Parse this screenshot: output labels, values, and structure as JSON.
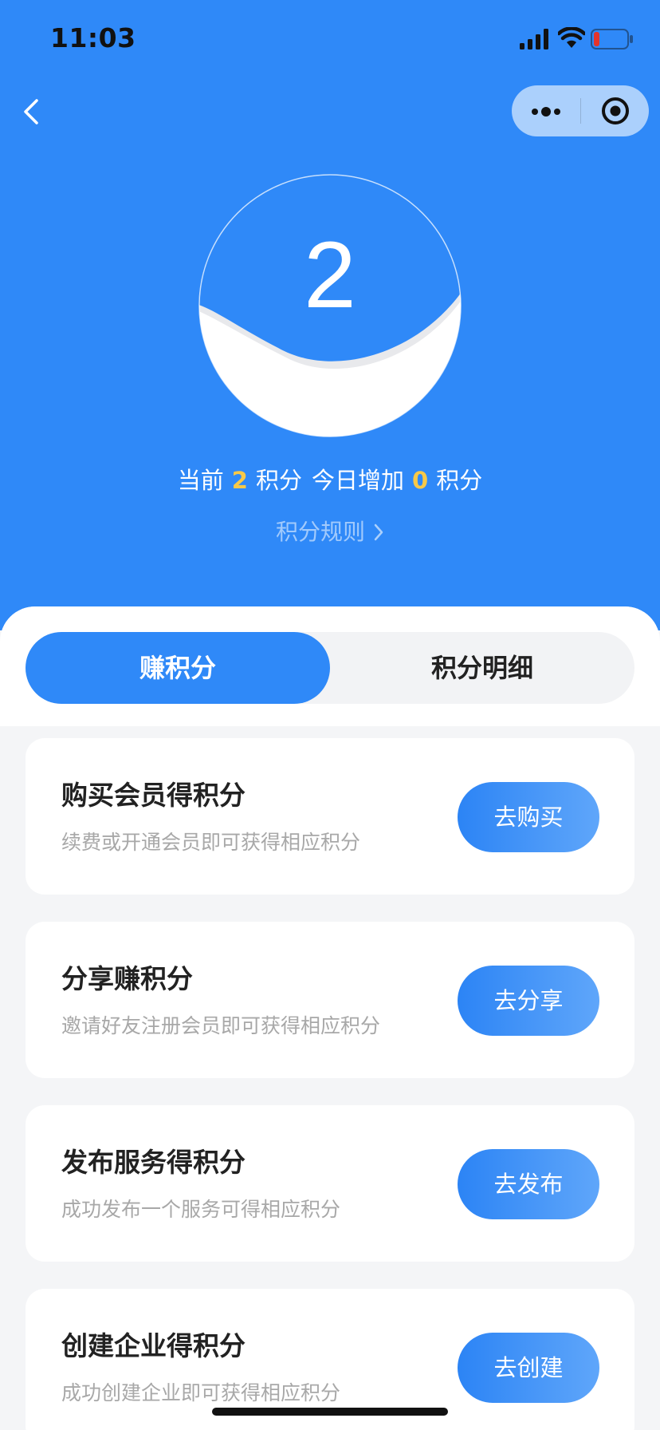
{
  "status_bar": {
    "time": "11:03"
  },
  "nav": {
    "back_icon": "chevron-left-icon",
    "capsule_more_icon": "more-dots-icon",
    "capsule_close_icon": "target-close-icon"
  },
  "points": {
    "current_value": "2",
    "summary_prefix": "当前",
    "current": "2",
    "points_unit": "积分",
    "today_label": "今日增加",
    "today_added": "0",
    "rules_link": "积分规则"
  },
  "tabs": [
    {
      "label": "赚积分",
      "active": true
    },
    {
      "label": "积分明细",
      "active": false
    }
  ],
  "tasks": [
    {
      "title": "购买会员得积分",
      "desc": "续费或开通会员即可获得相应积分",
      "button": "去购买"
    },
    {
      "title": "分享赚积分",
      "desc": "邀请好友注册会员即可获得相应积分",
      "button": "去分享"
    },
    {
      "title": "发布服务得积分",
      "desc": "成功发布一个服务可得相应积分",
      "button": "去发布"
    },
    {
      "title": "创建企业得积分",
      "desc": "成功创建企业即可获得相应积分",
      "button": "去创建"
    }
  ],
  "colors": {
    "primary": "#2F89F8",
    "highlight": "#F7C948",
    "background": "#F4F5F7"
  }
}
